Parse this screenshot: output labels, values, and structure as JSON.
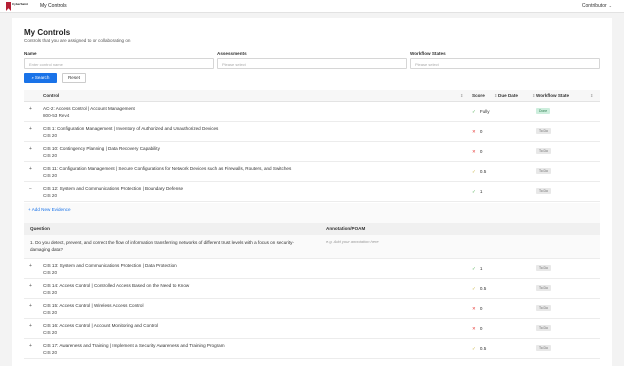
{
  "topbar": {
    "logo_text_line1": "CyberSaint",
    "logo_text_line2": "",
    "title": "My Controls",
    "role": "Contributor"
  },
  "header": {
    "title": "My Controls",
    "subtitle": "Controls that you are assigned to or collaborating on"
  },
  "filters": {
    "name_label": "Name",
    "name_placeholder": "Enter control name",
    "assessments_label": "Assessments",
    "assessments_placeholder": "Please select",
    "workflow_label": "Workflow States",
    "workflow_placeholder": "Please select",
    "search_label": "Search",
    "reset_label": "Reset"
  },
  "table": {
    "columns": [
      "Control",
      "Score",
      "Due Date",
      "Workflow State"
    ],
    "rows": [
      {
        "expander": "+",
        "title": "AC-2: Access Control | Account Management",
        "framework": "800-53 Rev4",
        "score_mark": "✓",
        "score": "Fully",
        "state": "Done"
      },
      {
        "expander": "+",
        "title": "CIS 1: Configuration Management | Inventory of Authorized and Unauthorized Devices",
        "framework": "CIS 20",
        "score_mark": "✕",
        "score": "0",
        "state": "To Do"
      },
      {
        "expander": "+",
        "title": "CIS 10: Contingency Planning | Data Recovery Capability",
        "framework": "CIS 20",
        "score_mark": "✕",
        "score": "0",
        "state": "To Do"
      },
      {
        "expander": "+",
        "title": "CIS 11: Configuration Management | Secure Configurations for Network Devices such as Firewalls, Routers, and Switches",
        "framework": "CIS 20",
        "score_mark": "✓",
        "score": "0.5",
        "state": "To Do"
      },
      {
        "expander": "−",
        "title": "CIS 12: System and Communications Protection | Boundary Defense",
        "framework": "CIS 20",
        "score_mark": "✓",
        "score": "1",
        "state": "To Do"
      },
      {
        "expander": "+",
        "title": "CIS 13: System and Communications Protection | Data Protection",
        "framework": "CIS 20",
        "score_mark": "✓",
        "score": "1",
        "state": "To Do"
      },
      {
        "expander": "+",
        "title": "CIS 14: Access Control | Controlled Access Based on the Need to Know",
        "framework": "CIS 20",
        "score_mark": "✓",
        "score": "0.5",
        "state": "To Do"
      },
      {
        "expander": "+",
        "title": "CIS 15: Access Control | Wireless Access Control",
        "framework": "CIS 20",
        "score_mark": "✕",
        "score": "0",
        "state": "To Do"
      },
      {
        "expander": "+",
        "title": "CIS 16: Access Control | Account Monitoring and Control",
        "framework": "CIS 20",
        "score_mark": "✕",
        "score": "0",
        "state": "To Do"
      },
      {
        "expander": "+",
        "title": "CIS 17: Awareness and Training | Implement a Security Awareness and Training Program",
        "framework": "CIS 20",
        "score_mark": "✓",
        "score": "0.5",
        "state": "To Do"
      }
    ]
  },
  "expanded": {
    "add_evidence": "+ Add New Evidence",
    "question_header": "Question",
    "annotation_header": "Annotation/POAM",
    "question": "1. Do you detect, prevent, and correct the flow of information transferring networks of different trust levels with a focus on security-damaging data?",
    "annotation_placeholder": "e.g. Add your annotation here"
  },
  "colors": {
    "accent": "#1a73e8",
    "done_bg": "#cdeedd",
    "error": "#e53935",
    "success": "#4caf50"
  }
}
